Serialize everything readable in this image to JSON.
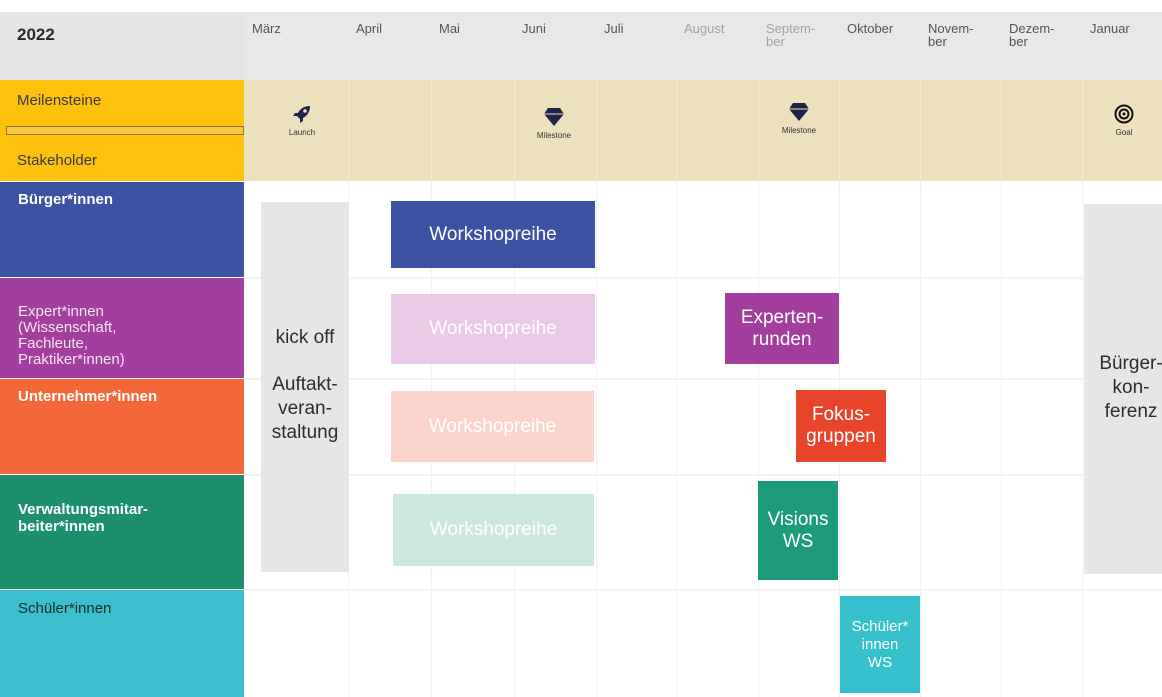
{
  "header": {
    "year": "2022",
    "months": [
      "März",
      "April",
      "Mai",
      "Juni",
      "Juli",
      "August",
      "Septem-\nber",
      "Oktober",
      "Novem-\nber",
      "Dezem-\nber",
      "Januar"
    ]
  },
  "milestones": {
    "row_title": "Meilensteine",
    "sub_title": "Stakeholder",
    "items": [
      {
        "icon": "rocket-icon",
        "glyph": "🚀",
        "caption": "Launch"
      },
      {
        "icon": "diamond-icon",
        "glyph": "♦",
        "caption": "Milestone"
      },
      {
        "icon": "diamond-icon",
        "glyph": "♦",
        "caption": "Milestone"
      },
      {
        "icon": "target-icon",
        "glyph": "◎",
        "caption": "Goal"
      }
    ]
  },
  "stakeholders": [
    {
      "label": "Bürger*innen",
      "color": "#3d52a3"
    },
    {
      "label": "Expert*innen\n(Wissenschaft,\nFachleute,\nPraktiker*innen)",
      "color": "#a23e9e"
    },
    {
      "label": "Unternehmer*innen",
      "color": "#f26838"
    },
    {
      "label": "Verwaltungsmitar-\nbeiter*innen",
      "color": "#1d8f6f"
    },
    {
      "label": "Schüler*innen",
      "color": "#3bbfcc"
    }
  ],
  "activities": {
    "kickoff": {
      "line1": "kick off",
      "line2": "Auftakt-\nveran-\nstaltung"
    },
    "workshop_buerger": "Workshopreihe",
    "workshop_experten": "Workshopreihe",
    "workshop_unternehmer": "Workshopreihe",
    "workshop_verwaltung": "Workshopreihe",
    "expertenrunden": "Experten-\nrunden",
    "fokusgruppen": "Fokus-\ngruppen",
    "visions_ws": "Visions\nWS",
    "schueler_ws": "Schüler*\ninnen\nWS",
    "buergerkonferenz": "Bürger-\nkon-\nferenz"
  },
  "colors": {
    "milestone_label": "#fdc10e",
    "milestone_band": "#ece0bd",
    "header": "#e8e8e8",
    "buerger_workshop": "#3d52a3",
    "experten_workshop": "#ebcae7",
    "unternehmer_workshop": "#fbd5cb",
    "verwaltung_workshop": "#cde8e1",
    "expertenrunden": "#a23e9e",
    "fokusgruppen": "#e8432b",
    "visions_ws": "#1d9a7a",
    "schueler_ws": "#36c0cb"
  }
}
